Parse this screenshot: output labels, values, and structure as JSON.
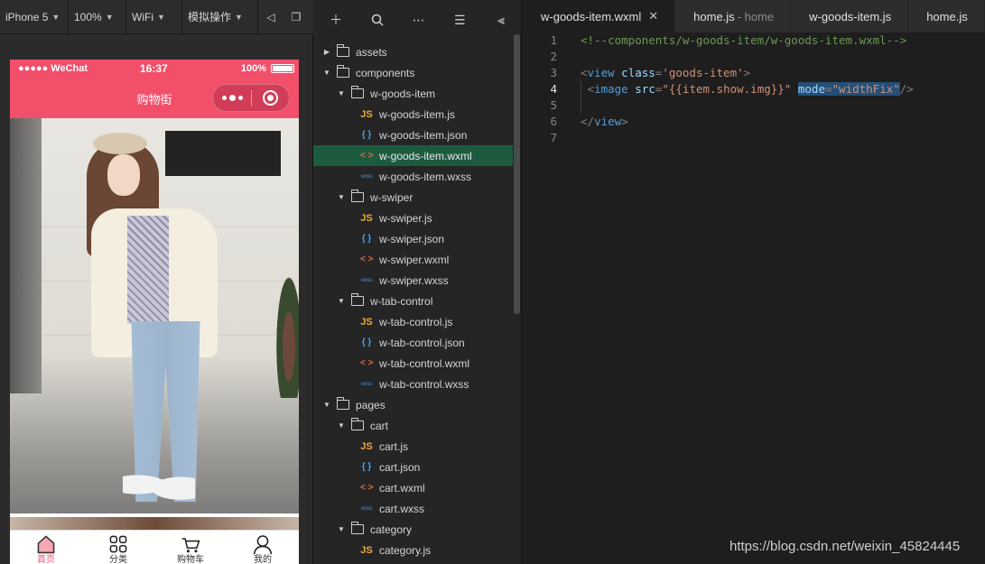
{
  "simulator": {
    "toolbar": {
      "device": "iPhone 5",
      "zoom": "100%",
      "network": "WiFi",
      "simulate": "模拟操作"
    },
    "status_bar": {
      "carrier": "●●●●● WeChat",
      "time": "16:37",
      "battery": "100%"
    },
    "nav_title": "购物街",
    "tabs": [
      {
        "label": "首页",
        "icon": "home-icon",
        "active": true
      },
      {
        "label": "分类",
        "icon": "category-grid-icon",
        "active": false
      },
      {
        "label": "购物车",
        "icon": "cart-icon",
        "active": false
      },
      {
        "label": "我的",
        "icon": "profile-icon",
        "active": false
      }
    ],
    "accent": "#f24f6b"
  },
  "file_tree": {
    "items": [
      {
        "type": "folder",
        "name": "assets",
        "expanded": false
      },
      {
        "type": "folder",
        "name": "components",
        "expanded": true
      },
      {
        "type": "folder",
        "name": "w-goods-item",
        "expanded": true
      },
      {
        "type": "js",
        "name": "w-goods-item.js"
      },
      {
        "type": "json",
        "name": "w-goods-item.json"
      },
      {
        "type": "wxml",
        "name": "w-goods-item.wxml",
        "selected": true
      },
      {
        "type": "wxss",
        "name": "w-goods-item.wxss"
      },
      {
        "type": "folder",
        "name": "w-swiper",
        "expanded": true
      },
      {
        "type": "js",
        "name": "w-swiper.js"
      },
      {
        "type": "json",
        "name": "w-swiper.json"
      },
      {
        "type": "wxml",
        "name": "w-swiper.wxml"
      },
      {
        "type": "wxss",
        "name": "w-swiper.wxss"
      },
      {
        "type": "folder",
        "name": "w-tab-control",
        "expanded": true
      },
      {
        "type": "js",
        "name": "w-tab-control.js"
      },
      {
        "type": "json",
        "name": "w-tab-control.json"
      },
      {
        "type": "wxml",
        "name": "w-tab-control.wxml"
      },
      {
        "type": "wxss",
        "name": "w-tab-control.wxss"
      },
      {
        "type": "folder",
        "name": "pages",
        "expanded": true
      },
      {
        "type": "folder",
        "name": "cart",
        "expanded": true
      },
      {
        "type": "js",
        "name": "cart.js"
      },
      {
        "type": "json",
        "name": "cart.json"
      },
      {
        "type": "wxml",
        "name": "cart.wxml"
      },
      {
        "type": "wxss",
        "name": "cart.wxss"
      },
      {
        "type": "folder",
        "name": "category",
        "expanded": true
      },
      {
        "type": "js",
        "name": "category.js"
      }
    ],
    "icon_text": {
      "js": "JS",
      "json": "{ }",
      "wxml": "< >",
      "wxss": "wxss"
    }
  },
  "editor": {
    "tabs": [
      {
        "label": "w-goods-item.wxml",
        "active": true,
        "closable": true
      },
      {
        "label": "home.js",
        "sub": "- home"
      },
      {
        "label": "w-goods-item.js"
      },
      {
        "label": "home.js"
      }
    ],
    "current_line": 4,
    "lines": [
      {
        "num": "1",
        "tokens": [
          {
            "t": "<!--components/w-goods-item/w-goods-item.wxml-->",
            "c": "com"
          }
        ]
      },
      {
        "num": "2",
        "tokens": []
      },
      {
        "num": "3",
        "tokens": [
          {
            "t": "<",
            "c": "punc"
          },
          {
            "t": "view",
            "c": "tag"
          },
          {
            "t": " class",
            "c": "attr"
          },
          {
            "t": "=",
            "c": "punc"
          },
          {
            "t": "'goods-item'",
            "c": "str"
          },
          {
            "t": ">",
            "c": "punc"
          }
        ]
      },
      {
        "num": "4",
        "tokens": [
          {
            "t": " <",
            "c": "punc"
          },
          {
            "t": "image",
            "c": "tag"
          },
          {
            "t": " src",
            "c": "attr"
          },
          {
            "t": "=",
            "c": "punc"
          },
          {
            "t": "\"{{item.show.img}}\"",
            "c": "str"
          },
          {
            "t": " ",
            "c": "punc"
          },
          {
            "t": "mode",
            "c": "attr",
            "hl": true
          },
          {
            "t": "=",
            "c": "punc",
            "hl": true
          },
          {
            "t": "\"widthFix\"",
            "c": "str",
            "hl": true
          },
          {
            "t": "/>",
            "c": "punc"
          }
        ]
      },
      {
        "num": "5",
        "tokens": []
      },
      {
        "num": "6",
        "tokens": [
          {
            "t": "</",
            "c": "punc"
          },
          {
            "t": "view",
            "c": "tag"
          },
          {
            "t": ">",
            "c": "punc"
          }
        ]
      },
      {
        "num": "7",
        "tokens": []
      }
    ]
  },
  "watermark": "https://blog.csdn.net/weixin_45824445"
}
